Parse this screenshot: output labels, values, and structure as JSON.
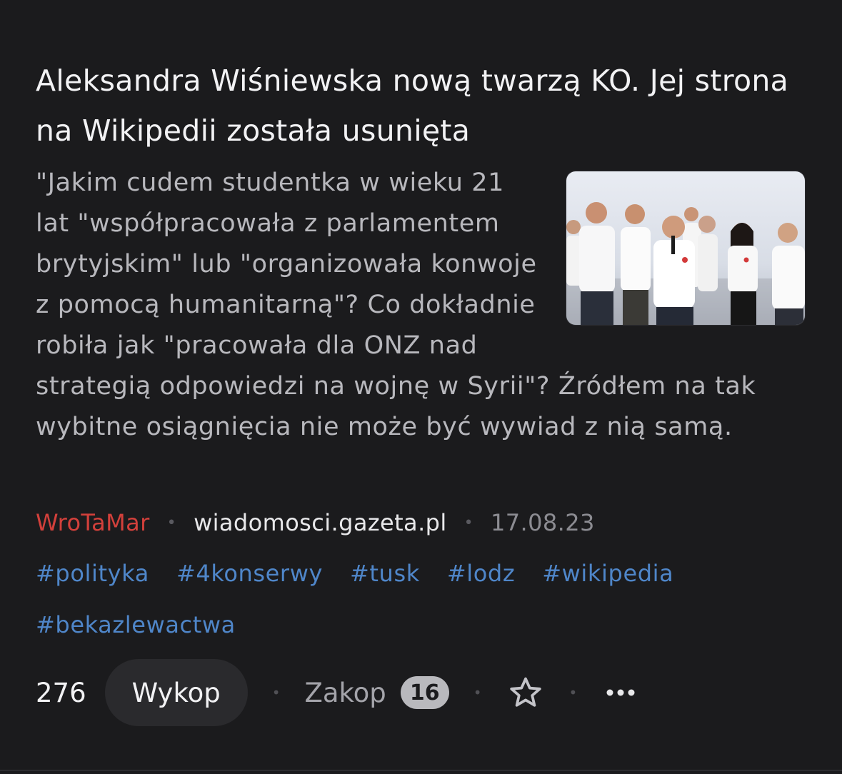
{
  "post": {
    "title": "Aleksandra Wiśniewska nową twarzą KO. Jej strona na Wikipedii została usunięta",
    "excerpt": "\"Jakim cudem studentka w wieku 21 lat \"współpracowała z parlamentem brytyjskim\" lub \"organizowała konwoje z pomocą humanitarną\"? Co dokładnie robiła jak \"pracowała dla ONZ nad strategią odpowiedzi na wojnę w Syrii\"? Źródłem na tak wybitne osiągnięcia nie może być wywiad z nią samą.",
    "author": "WroTaMar",
    "source": "wiadomosci.gazeta.pl",
    "date": "17.08.23",
    "meta_separator": "•"
  },
  "tags": [
    "#polityka",
    "#4konserwy",
    "#tusk",
    "#lodz",
    "#wikipedia",
    "#bekazlewactwa"
  ],
  "actions": {
    "vote_count": "276",
    "wykop_label": "Wykop",
    "zakop_label": "Zakop",
    "zakop_count": "16",
    "separator": "•",
    "favorite_icon": "star-icon",
    "more_icon": "more-dots-icon"
  },
  "colors": {
    "background": "#1b1b1d",
    "author": "#d2403b",
    "tag": "#4f86c9",
    "button_bg": "#2a2a2d"
  }
}
